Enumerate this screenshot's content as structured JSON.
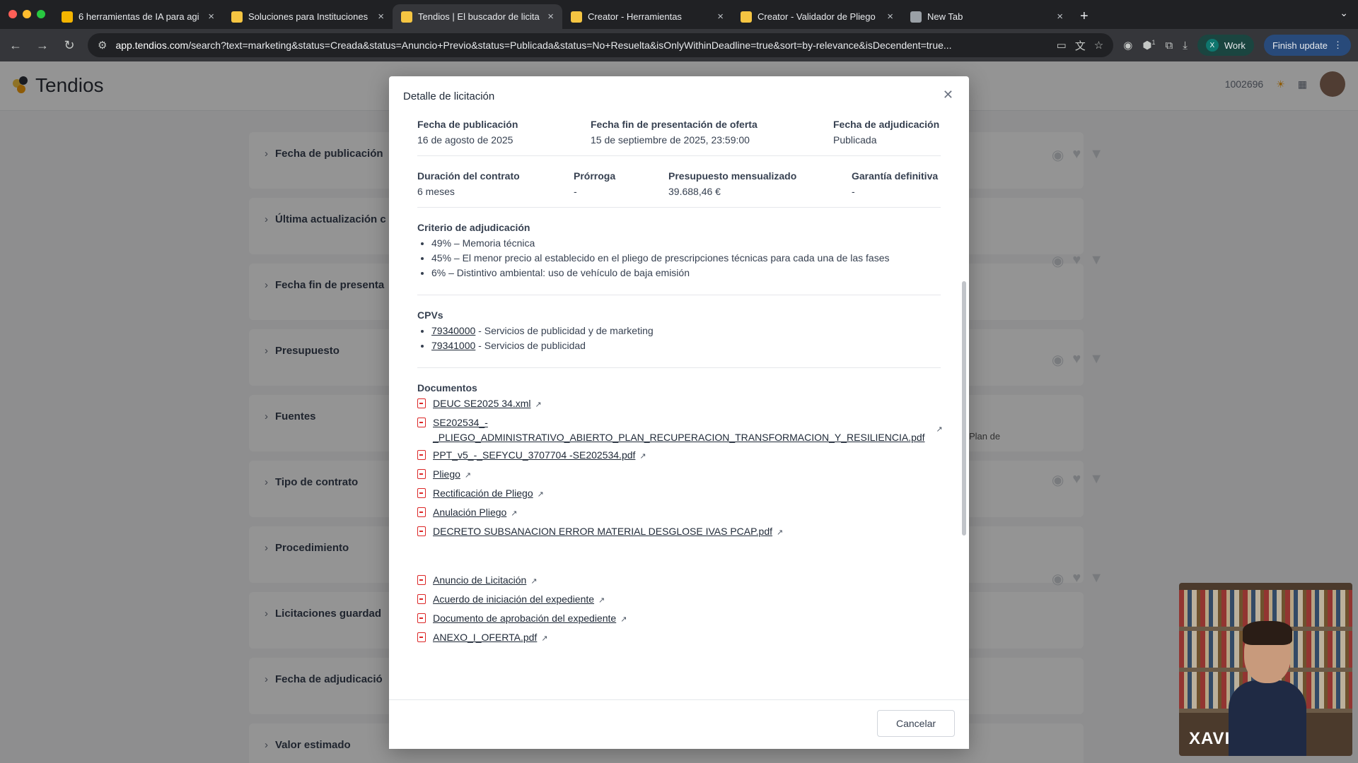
{
  "browser": {
    "tabs": [
      {
        "title": "6 herramientas de IA para agi",
        "favicon_color": "#f4b400",
        "active": false
      },
      {
        "title": "Soluciones para Instituciones",
        "favicon_color": "#f5c542",
        "active": false
      },
      {
        "title": "Tendios | El buscador de licita",
        "favicon_color": "#f5c542",
        "active": true
      },
      {
        "title": "Creator - Herramientas",
        "favicon_color": "#f5c542",
        "active": false
      },
      {
        "title": "Creator - Validador de Pliego",
        "favicon_color": "#f5c542",
        "active": false
      },
      {
        "title": "New Tab",
        "favicon_color": "#9aa0a6",
        "active": false
      }
    ],
    "url_host": "app.tendios.com",
    "url_rest": "/search?text=marketing&status=Creada&status=Anuncio+Previo&status=Publicada&status=No+Resuelta&isOnlyWithinDeadline=true&sort=by-relevance&isDecendent=true...",
    "profile_label": "Work",
    "profile_initial": "X",
    "update_label": "Finish update",
    "extension_badge": "1"
  },
  "app": {
    "logo_text": "Tendios",
    "user_id": "1002696",
    "filters": [
      "Fecha de publicación",
      "Última actualización c",
      "Fecha fin de presenta",
      "Presupuesto",
      "Fuentes",
      "Tipo de contrato",
      "Procedimiento",
      "Licitaciones guardad",
      "Fecha de adjudicació",
      "Valor estimado"
    ],
    "bg_snippet": "Plan de"
  },
  "modal": {
    "title": "Detalle de licitación",
    "row1": [
      {
        "label": "Fecha de publicación",
        "value": "16 de agosto de 2025"
      },
      {
        "label": "Fecha fin de presentación de oferta",
        "value": "15 de septiembre de 2025, 23:59:00"
      },
      {
        "label": "Fecha de adjudicación",
        "value": "Publicada"
      }
    ],
    "row2": [
      {
        "label": "Duración del contrato",
        "value": "6 meses"
      },
      {
        "label": "Prórroga",
        "value": "-"
      },
      {
        "label": "Presupuesto mensualizado",
        "value": "39.688,46 €"
      },
      {
        "label": "Garantía definitiva",
        "value": "-"
      }
    ],
    "criteria_title": "Criterio de adjudicación",
    "criteria": [
      "49% – Memoria técnica",
      "45% – El menor precio al establecido en el pliego de prescripciones técnicas para cada una de las fases",
      "6% – Distintivo ambiental: uso de vehículo de baja emisión"
    ],
    "cpv_title": "CPVs",
    "cpvs": [
      {
        "code": "79340000",
        "desc": " - Servicios de publicidad y de marketing"
      },
      {
        "code": "79341000",
        "desc": " - Servicios de publicidad"
      }
    ],
    "docs_title": "Documentos",
    "docs_a": [
      "DEUC SE2025 34.xml",
      "PPT_v5_-_SEFYCU_3707704 -SE202534.pdf",
      "Pliego",
      "Rectificación de Pliego",
      "Anulación Pliego",
      "DECRETO SUBSANACION ERROR MATERIAL DESGLOSE IVAS PCAP.pdf"
    ],
    "doc_long_line1": "SE202534_-",
    "doc_long_line2": "_PLIEGO_ADMINISTRATIVO_ABIERTO_PLAN_RECUPERACION_TRANSFORMACION_Y_RESILIENCIA.pdf",
    "docs_b": [
      "Anuncio de Licitación",
      "Acuerdo de iniciación del expediente",
      "Documento de aprobación del expediente",
      "ANEXO_I_OFERTA.pdf"
    ],
    "cancel_label": "Cancelar"
  },
  "webcam": {
    "name": "XAVI"
  }
}
